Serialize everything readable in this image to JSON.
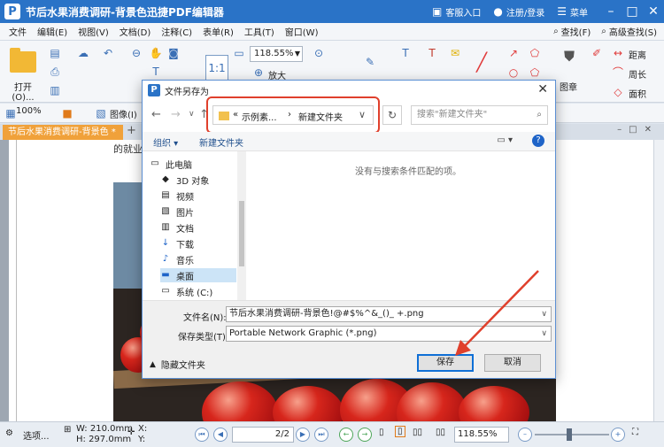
{
  "titlebar": {
    "logo": "P",
    "title": "节后水果消费调研-背景色迅捷PDF编辑器",
    "service": "客服入口",
    "register": "注册/登录",
    "menu": "菜单"
  },
  "menubar": {
    "items": [
      "文件",
      "编辑(E)",
      "视图(V)",
      "文档(D)",
      "注释(C)",
      "表单(R)",
      "工具(T)",
      "窗口(W)"
    ],
    "find": "查找(F)",
    "advanced_find": "高级查找(S)"
  },
  "ribbon": {
    "open_label": "打开(O)...",
    "zoom_value": "118.55%",
    "enlarge_label": "放大",
    "distance_label": "距离",
    "perimeter_label": "周长",
    "area_label": "面积",
    "stamp_label": "图章"
  },
  "toolbar2": {
    "zoom": "100%",
    "image_label": "图像(I)"
  },
  "doc_tab": {
    "name": "节后水果消费调研-背景色 *"
  },
  "page": {
    "visible_text": "的就业和"
  },
  "dialog": {
    "title": "文件另存为",
    "address_crumbs": [
      "«",
      "示例素...",
      "›",
      "新建文件夹"
    ],
    "search_placeholder": "搜索\"新建文件夹\"",
    "organize": "组织 ▾",
    "new_folder": "新建文件夹",
    "tree": [
      {
        "icon": "computer-icon",
        "label": "此电脑",
        "selected": false
      },
      {
        "icon": "3d-objects-icon",
        "label": "3D 对象",
        "selected": false
      },
      {
        "icon": "video-folder-icon",
        "label": "视频",
        "selected": false
      },
      {
        "icon": "pictures-folder-icon",
        "label": "图片",
        "selected": false
      },
      {
        "icon": "documents-folder-icon",
        "label": "文档",
        "selected": false
      },
      {
        "icon": "downloads-folder-icon",
        "label": "下载",
        "selected": false
      },
      {
        "icon": "music-folder-icon",
        "label": "音乐",
        "selected": false
      },
      {
        "icon": "desktop-folder-icon",
        "label": "桌面",
        "selected": true
      },
      {
        "icon": "drive-icon",
        "label": "系统 (C:)",
        "selected": false
      }
    ],
    "empty_message": "没有与搜索条件匹配的项。",
    "filename_label": "文件名(N):",
    "filename_value": "节后水果消费调研-背景色!@#$%^&_()_ +.png",
    "filetype_label": "保存类型(T):",
    "filetype_value": "Portable Network Graphic (*.png)",
    "hide_folders": "隐藏文件夹",
    "save": "保存",
    "cancel": "取消"
  },
  "statusbar": {
    "select_label": "选项...",
    "width": "W: 210.0mm",
    "height": "H: 297.0mm",
    "x_label": "X:",
    "y_label": "Y:",
    "page_indicator": "2/2",
    "zoom": "118.55%"
  },
  "colors": {
    "title_blue": "#2a73c7",
    "tab_orange": "#f0a13a",
    "highlight_red": "#e0402c"
  }
}
